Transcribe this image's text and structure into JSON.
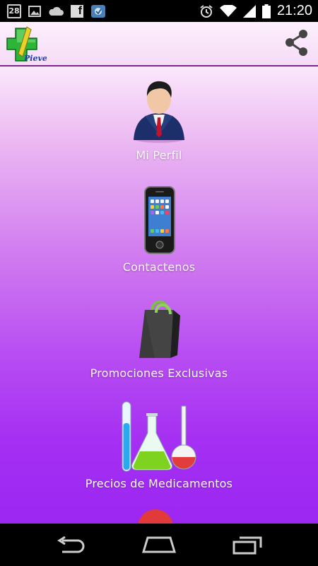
{
  "status_bar": {
    "calendar_day": "28",
    "icons": [
      "calendar-icon",
      "image-icon",
      "cloud-icon",
      "facebook-icon",
      "app-notification-icon",
      "alarm-icon",
      "wifi-icon",
      "signal-icon",
      "battery-icon"
    ],
    "time": "21:20"
  },
  "app_bar": {
    "logo_text": "Pieve",
    "share_icon": "share-icon"
  },
  "menu": {
    "items": [
      {
        "label": "Mi Perfil",
        "icon": "profile-person-icon"
      },
      {
        "label": "Contactenos",
        "icon": "smartphone-icon"
      },
      {
        "label": "Promociones Exclusivas",
        "icon": "shopping-bag-icon"
      },
      {
        "label": "Precios de Medicamentos",
        "icon": "lab-flasks-icon"
      }
    ]
  },
  "nav_bar": {
    "buttons": [
      "back-icon",
      "home-icon",
      "recents-icon"
    ]
  },
  "colors": {
    "accent": "#9b27f2",
    "app_bar_line": "#7b2a8c"
  }
}
